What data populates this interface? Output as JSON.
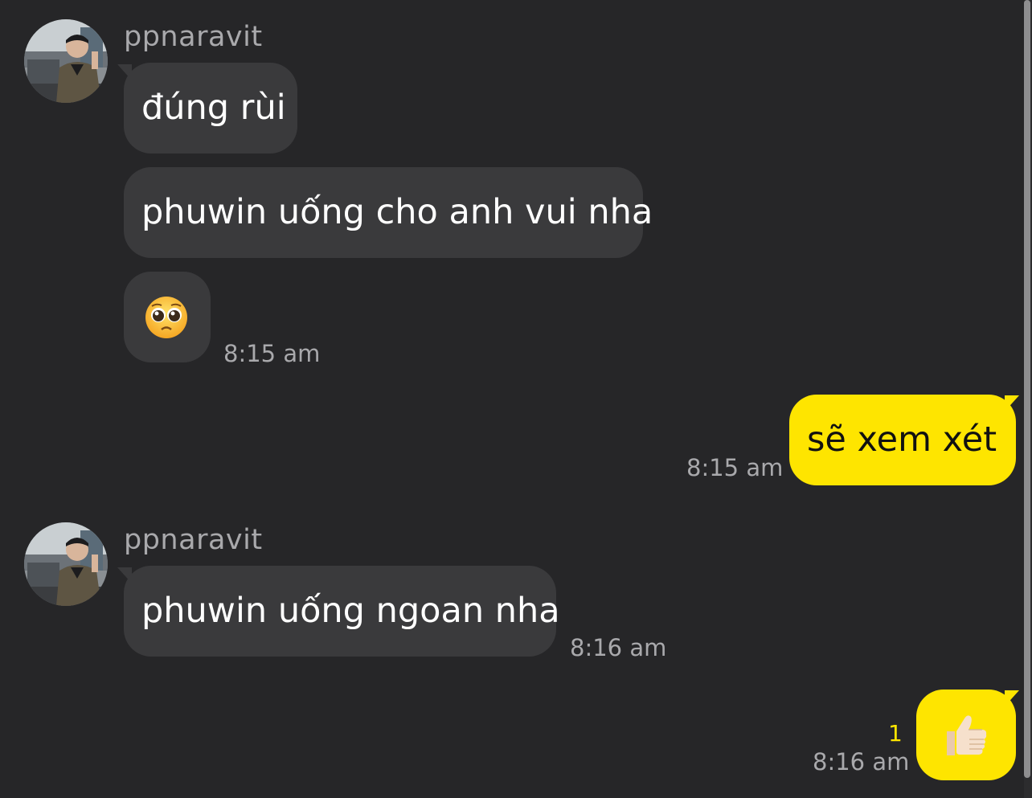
{
  "conversation": {
    "groups": [
      {
        "sender": "ppnaravit",
        "messages": [
          "đúng rùi",
          "phuwin uống cho anh vui nha"
        ],
        "emoji_message": "pleading-face-emoji",
        "time": "8:15 am"
      },
      {
        "from_me": true,
        "message": "sẽ xem xét",
        "time": "8:15 am"
      },
      {
        "sender": "ppnaravit",
        "message": "phuwin uống ngoan nha",
        "time": "8:16 am"
      },
      {
        "from_me": true,
        "emoji_message": "thumbs-up-emoji",
        "unread_count": "1",
        "time": "8:16 am"
      }
    ]
  },
  "colors": {
    "background": "#262628",
    "incoming_bubble": "#3a3a3c",
    "outgoing_bubble": "#fee500",
    "meta_text": "#a9a9ac",
    "unread_count": "#fee500"
  }
}
